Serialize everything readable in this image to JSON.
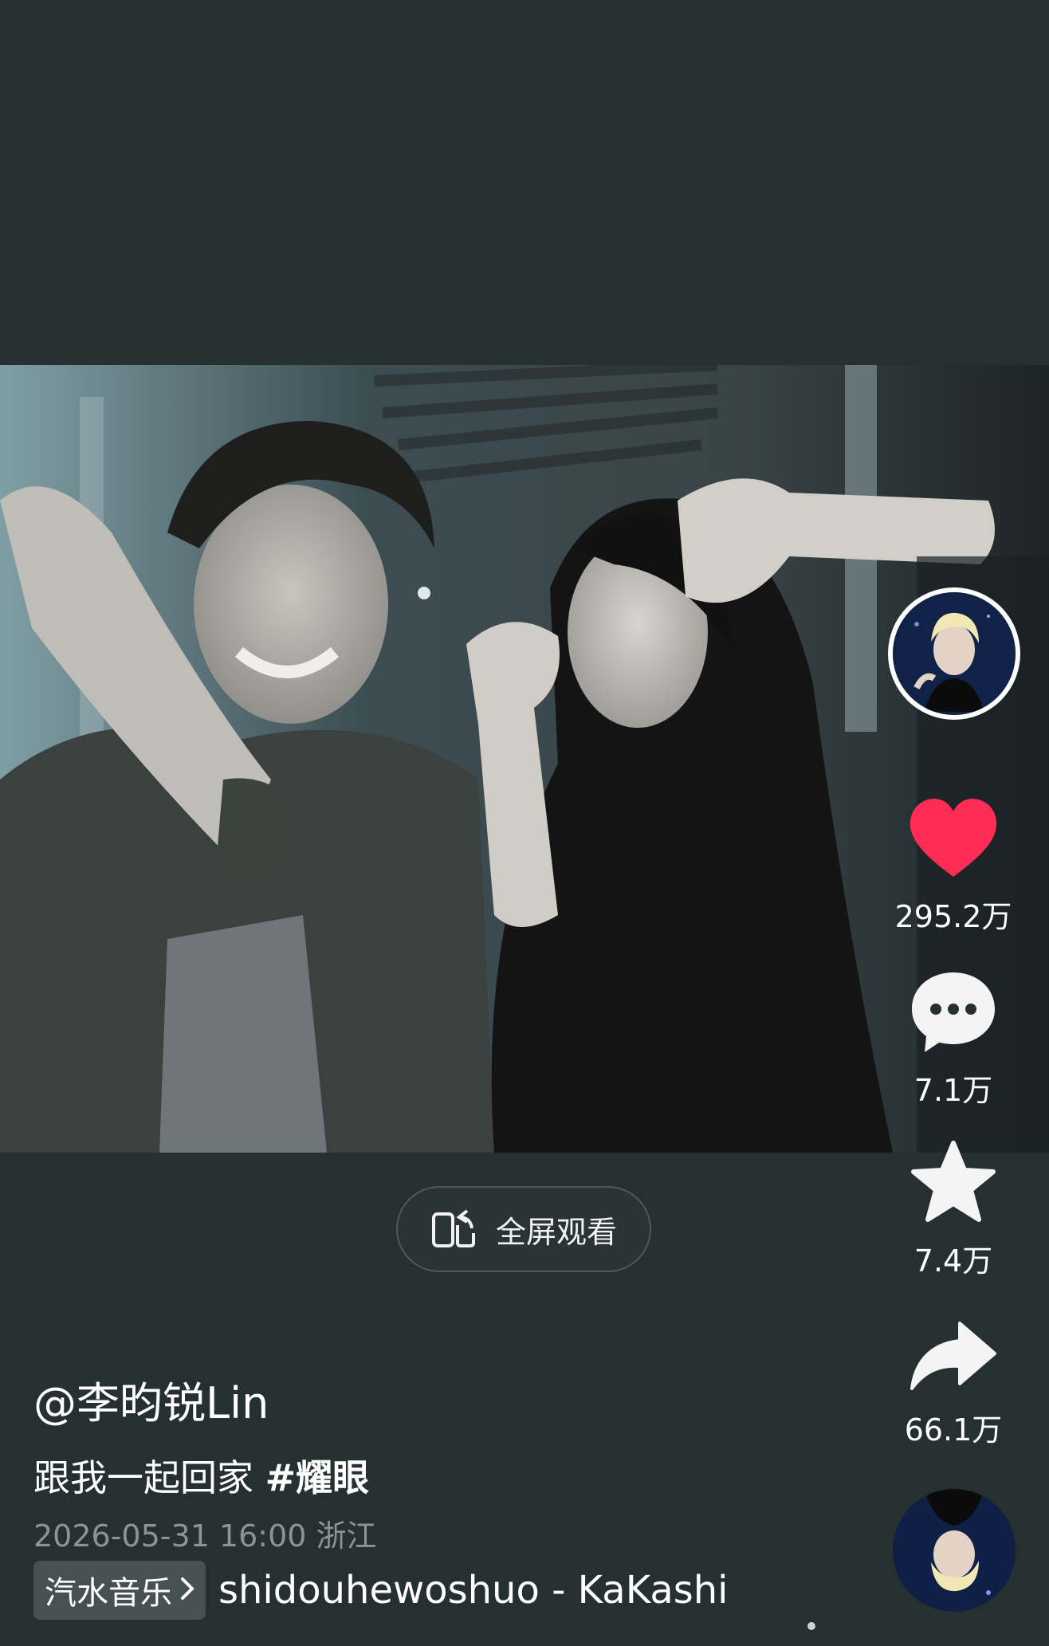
{
  "player": {
    "fullscreen_label": "全屏观看"
  },
  "actions": {
    "likes": "295.2万",
    "comments": "7.1万",
    "favorites": "7.4万",
    "shares": "66.1万"
  },
  "post": {
    "author": "@李昀锐Lin",
    "caption": "跟我一起回家",
    "hashtag": "#耀眼",
    "datetime": "2026-05-31 16:00",
    "location": "浙江"
  },
  "music": {
    "source_label": "汽水音乐",
    "track": "shidouhewoshuo - KaKashi"
  },
  "colors": {
    "background": "#263030",
    "like_red": "#ff2d55",
    "meta_gray": "#8d9494"
  },
  "icons": {
    "fullscreen": "rotate-screen-icon",
    "like": "heart-icon",
    "comment": "speech-bubble-icon",
    "favorite": "star-icon",
    "share": "share-arrow-icon"
  }
}
